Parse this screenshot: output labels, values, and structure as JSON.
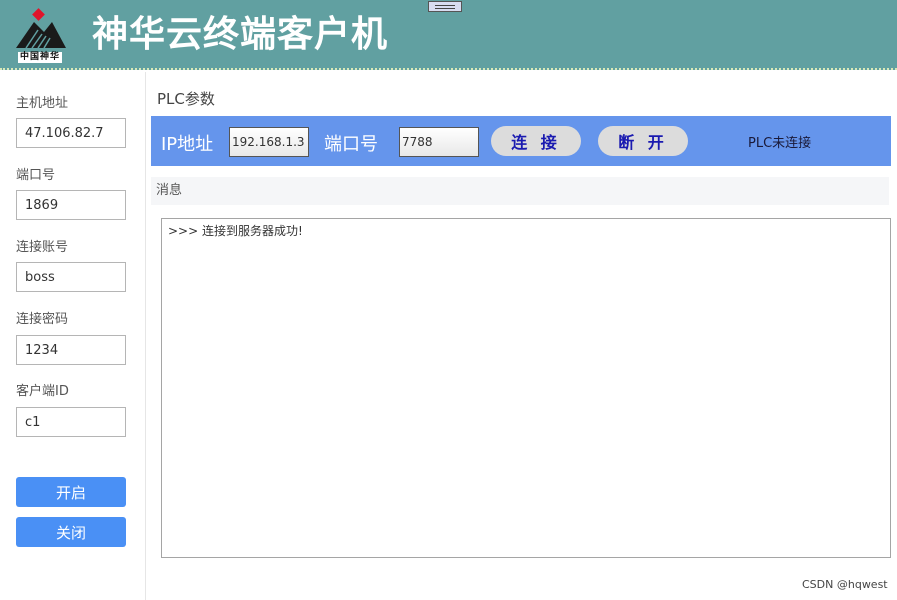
{
  "header": {
    "logo_caption": "中国神华",
    "title": "神华云终端客户机"
  },
  "sidebar": {
    "host": {
      "label": "主机地址",
      "value": "47.106.82.7"
    },
    "port": {
      "label": "端口号",
      "value": "1869"
    },
    "account": {
      "label": "连接账号",
      "value": "boss"
    },
    "password": {
      "label": "连接密码",
      "value": "1234"
    },
    "client_id": {
      "label": "客户端ID",
      "value": "c1"
    },
    "start_label": "开启",
    "close_label": "关闭"
  },
  "plc": {
    "heading": "PLC参数",
    "ip_label": "IP地址",
    "ip_value": "192.168.1.3",
    "port_label": "端口号",
    "port_value": "7788",
    "connect_label": "连 接",
    "disconnect_label": "断 开",
    "status": "PLC未连接"
  },
  "messages": {
    "heading": "消息",
    "lines": [
      ">>> 连接到服务器成功!"
    ]
  },
  "watermark": "CSDN @hqwest",
  "colors": {
    "header_bg": "#61a0a1",
    "plc_bar": "#6595ec",
    "primary_button": "#4a90f5",
    "plc_button_text": "#1a1ab0"
  }
}
